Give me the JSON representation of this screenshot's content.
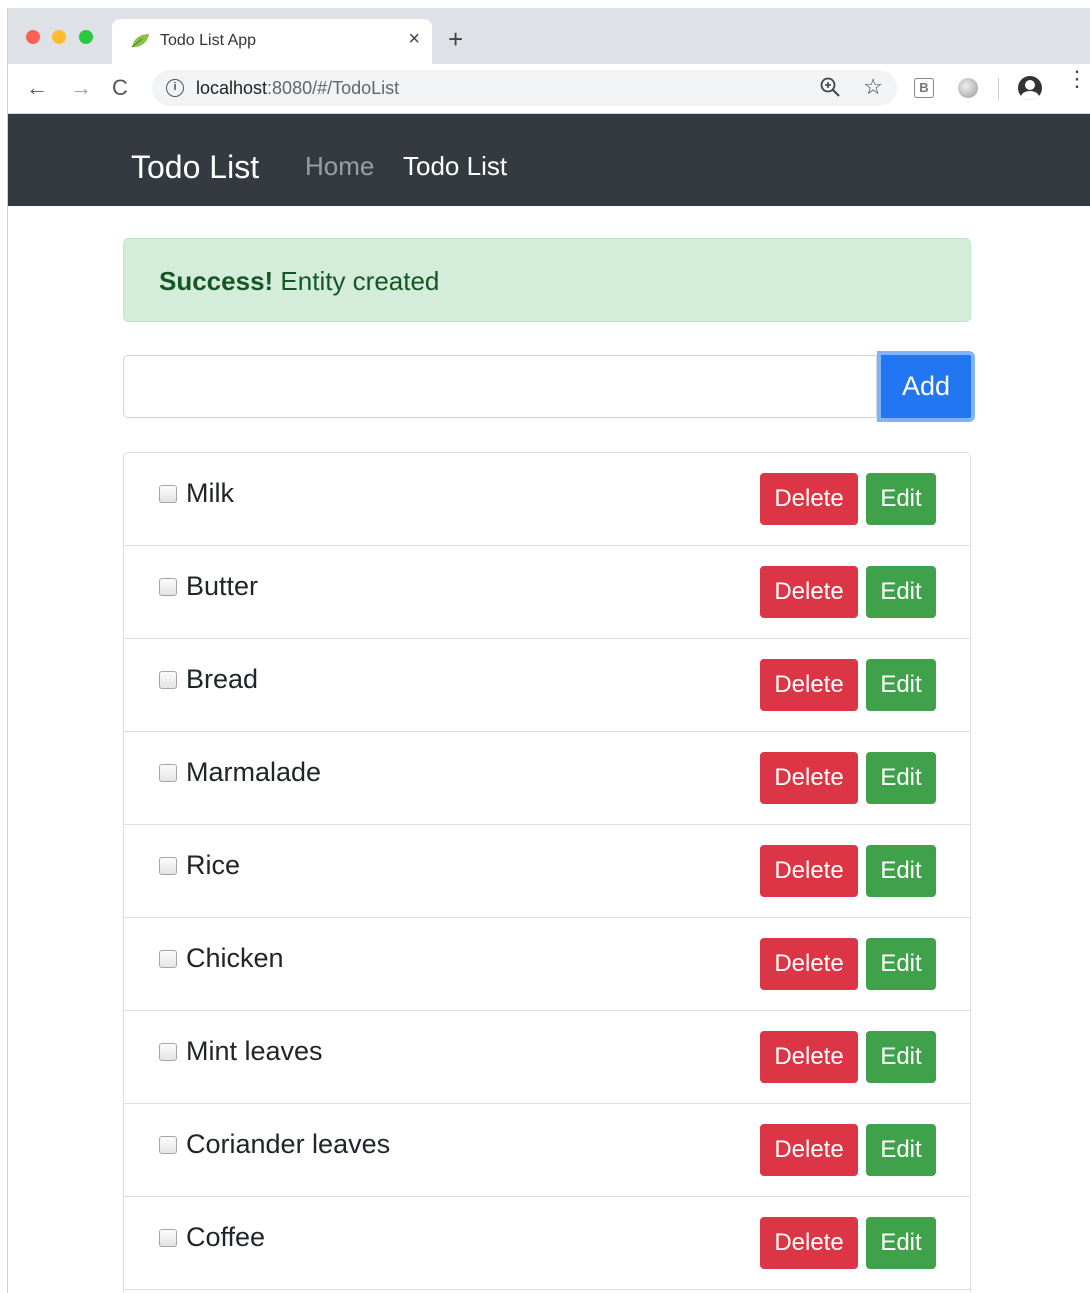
{
  "browser": {
    "tab_title": "Todo List App",
    "tab_close": "×",
    "new_tab": "+",
    "back": "←",
    "forward": "→",
    "reload": "C",
    "url_host": "localhost",
    "url_rest": ":8080/#/TodoList",
    "info": "i",
    "ext_b": "B",
    "star": "☆",
    "menu": "⋮"
  },
  "navbar": {
    "brand": "Todo List",
    "links": [
      {
        "label": "Home",
        "active": false
      },
      {
        "label": "Todo List",
        "active": true
      }
    ]
  },
  "alert": {
    "strong": "Success!",
    "message": "Entity created"
  },
  "form": {
    "input_value": "",
    "add_label": "Add"
  },
  "items": [
    {
      "label": "Milk",
      "checked": false
    },
    {
      "label": "Butter",
      "checked": false
    },
    {
      "label": "Bread",
      "checked": false
    },
    {
      "label": "Marmalade",
      "checked": false
    },
    {
      "label": "Rice",
      "checked": false
    },
    {
      "label": "Chicken",
      "checked": false
    },
    {
      "label": "Mint leaves",
      "checked": false
    },
    {
      "label": "Coriander leaves",
      "checked": false
    },
    {
      "label": "Coffee",
      "checked": false
    }
  ],
  "buttons": {
    "delete": "Delete",
    "edit": "Edit"
  },
  "colors": {
    "navbar_bg": "#343a40",
    "alert_bg": "#d4edda",
    "primary": "#2376f2",
    "danger": "#dc3545",
    "success": "#3fa24a"
  }
}
